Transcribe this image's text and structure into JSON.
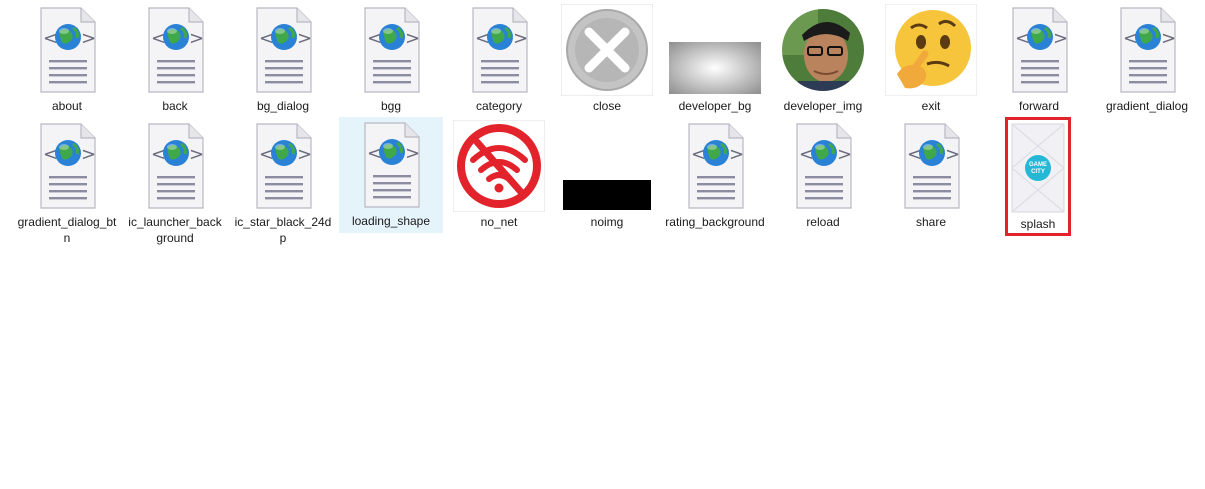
{
  "files": [
    {
      "name": "about",
      "type": "xml"
    },
    {
      "name": "back",
      "type": "xml"
    },
    {
      "name": "bg_dialog",
      "type": "xml"
    },
    {
      "name": "bgg",
      "type": "xml"
    },
    {
      "name": "category",
      "type": "xml"
    },
    {
      "name": "close",
      "type": "close-image"
    },
    {
      "name": "developer_bg",
      "type": "gradient-image"
    },
    {
      "name": "developer_img",
      "type": "photo"
    },
    {
      "name": "exit",
      "type": "emoji"
    },
    {
      "name": "forward",
      "type": "xml"
    },
    {
      "name": "gradient_dialog",
      "type": "xml"
    },
    {
      "name": "gradient_dialog_btn",
      "type": "xml"
    },
    {
      "name": "ic_launcher_background",
      "type": "xml"
    },
    {
      "name": "ic_star_black_24dp",
      "type": "xml"
    },
    {
      "name": "loading_shape",
      "type": "xml",
      "selected": true
    },
    {
      "name": "no_net",
      "type": "no-wifi-image"
    },
    {
      "name": "noimg",
      "type": "black-image"
    },
    {
      "name": "rating_background",
      "type": "xml"
    },
    {
      "name": "reload",
      "type": "xml"
    },
    {
      "name": "share",
      "type": "xml"
    },
    {
      "name": "splash",
      "type": "splash-image",
      "highlighted": true,
      "splash_text": "GAME CITY"
    }
  ],
  "colors": {
    "selection_bg": "#e5f3fb",
    "highlight_border": "#e3232b",
    "no_net_red": "#e3232b"
  }
}
